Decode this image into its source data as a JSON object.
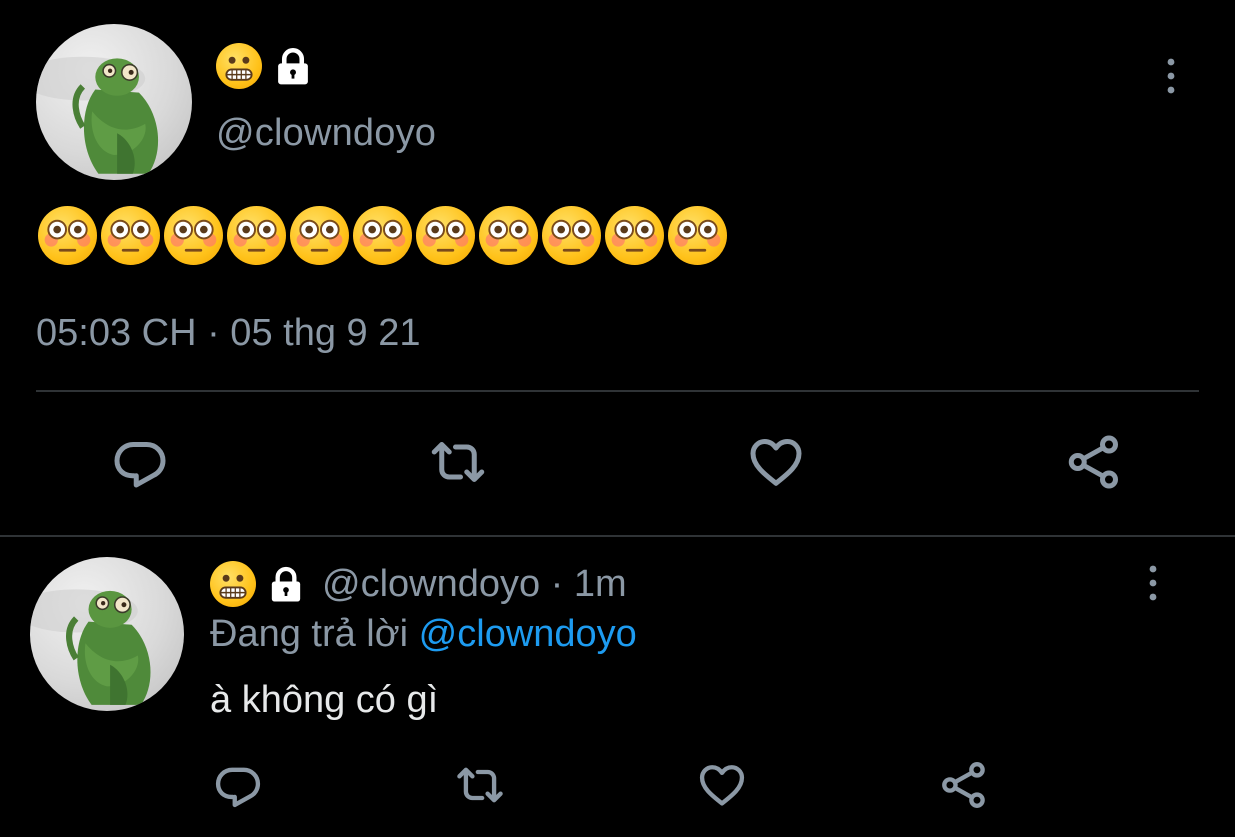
{
  "main_tweet": {
    "display_name_icon": "grimacing-face-emoji",
    "protected_icon": "lock-icon",
    "handle": "@clowndoyo",
    "content_emoji": "flushed-face-emoji",
    "content_emoji_count": 11,
    "timestamp": "05:03 CH · 05 thg 9 21",
    "actions": [
      "reply-icon",
      "retweet-icon",
      "like-icon",
      "share-icon"
    ]
  },
  "reply_tweet": {
    "display_name_icon": "grimacing-face-emoji",
    "protected_icon": "lock-icon",
    "handle_meta": "@clowndoyo · 1m",
    "replying_to_prefix": "Đang trả lời ",
    "replying_to_mention": "@clowndoyo",
    "text": "à không có gì",
    "actions": [
      "reply-icon",
      "retweet-icon",
      "like-icon",
      "share-icon"
    ]
  },
  "colors": {
    "background": "#000000",
    "secondary_text": "#8b98a5",
    "primary_text": "#e7e9ea",
    "mention": "#1d9bf0",
    "divider": "#2f3336"
  }
}
